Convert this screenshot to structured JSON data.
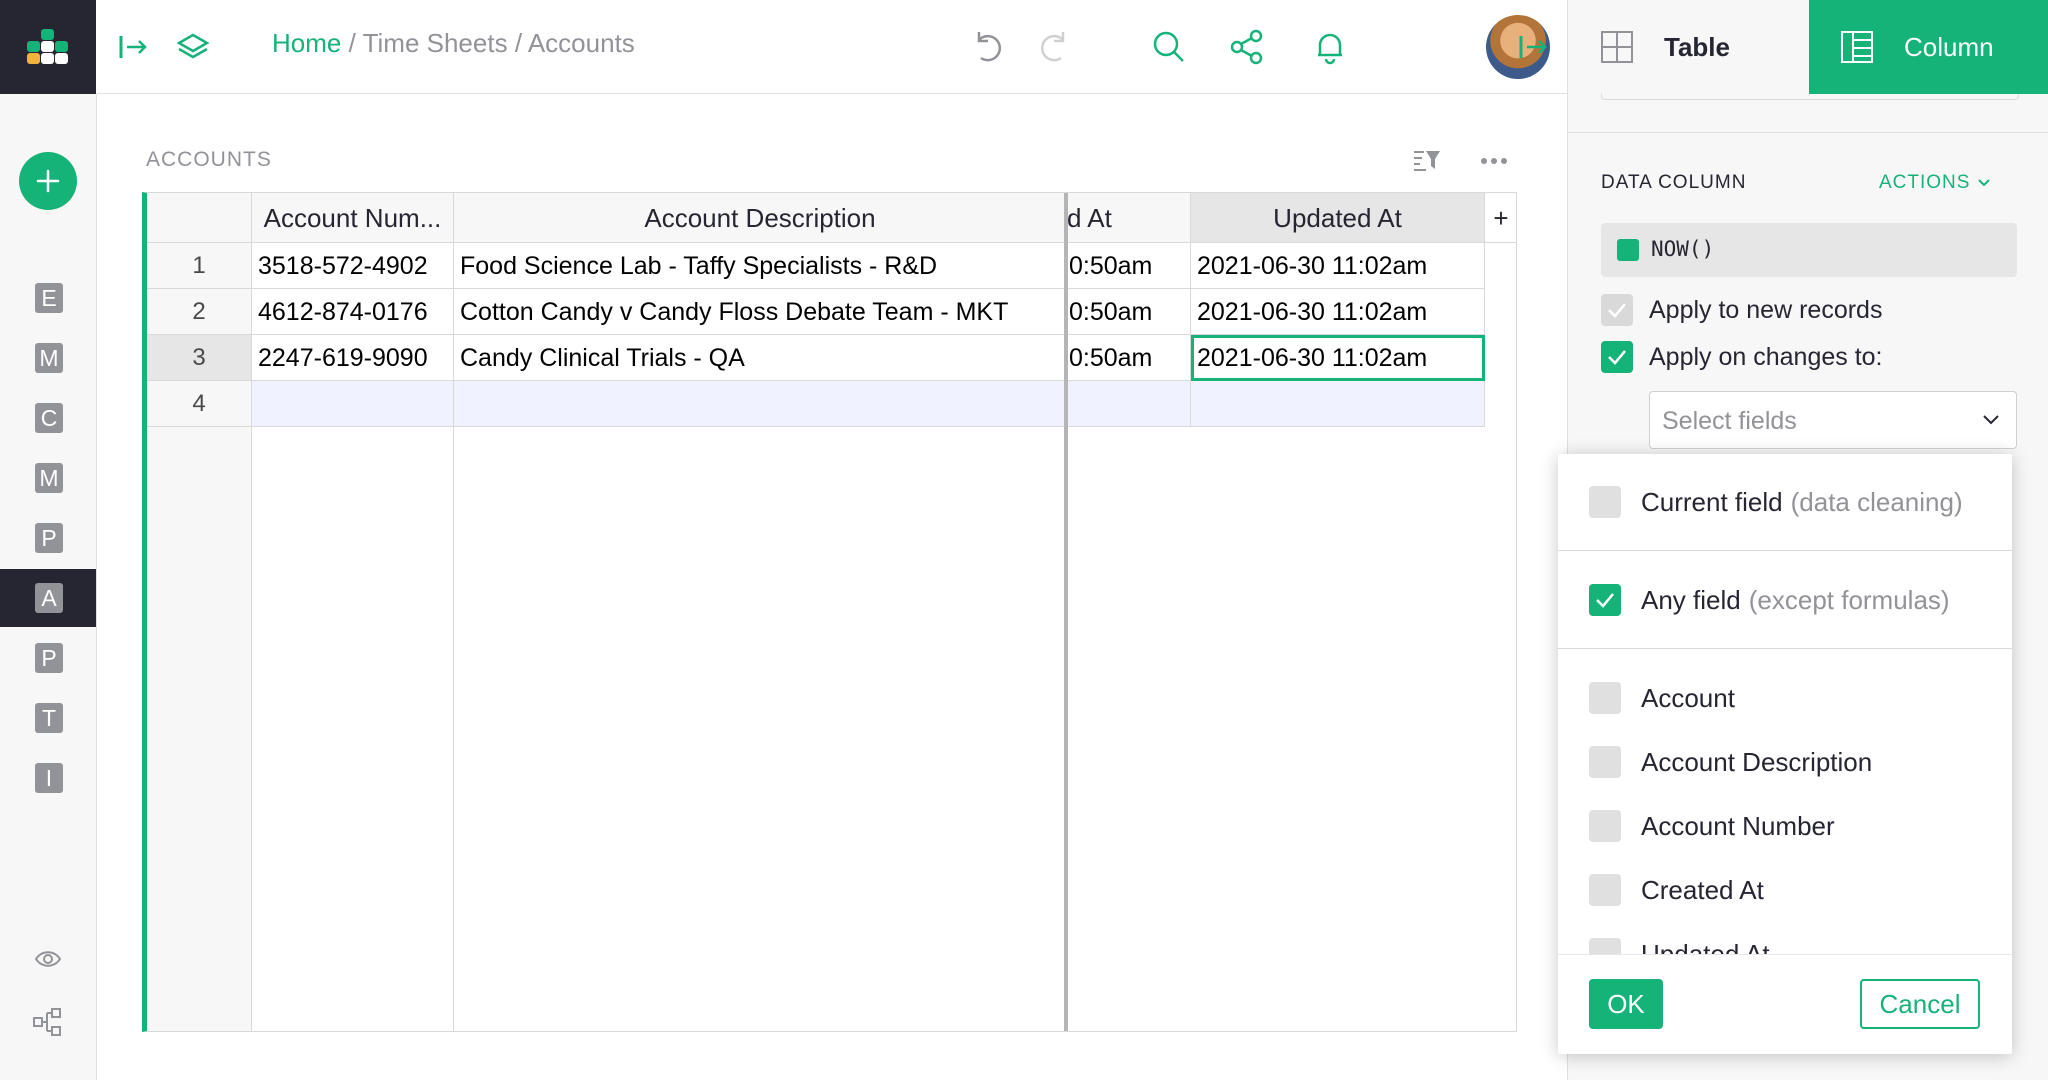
{
  "breadcrumb": {
    "home": "Home",
    "sep": "/",
    "doc": "Time Sheets",
    "page": "Accounts"
  },
  "pages": [
    "E",
    "M",
    "C",
    "M",
    "P",
    "A",
    "P",
    "T",
    "I"
  ],
  "section": {
    "title": "ACCOUNTS"
  },
  "grid": {
    "columns": [
      "Account Num...",
      "Account Description",
      "d At",
      "Updated At",
      "+"
    ],
    "rows": [
      {
        "n": "1",
        "number": "3518-572-4902",
        "desc": "Food Science Lab - Taffy Specialists - R&D",
        "created": "0:50am",
        "updated": "2021-06-30 11:02am"
      },
      {
        "n": "2",
        "number": "4612-874-0176",
        "desc": "Cotton Candy v Candy Floss Debate Team - MKT",
        "created": "0:50am",
        "updated": "2021-06-30 11:02am"
      },
      {
        "n": "3",
        "number": "2247-619-9090",
        "desc": "Candy Clinical Trials - QA",
        "created": "0:50am",
        "updated": "2021-06-30 11:02am"
      },
      {
        "n": "4",
        "number": "",
        "desc": "",
        "created": "",
        "updated": ""
      }
    ]
  },
  "panel": {
    "tab_table": "Table",
    "tab_column": "Column",
    "section_label": "DATA COLUMN",
    "actions": "ACTIONS",
    "formula": "NOW()",
    "apply_new": "Apply to new records",
    "apply_changes": "Apply on changes to:",
    "select_placeholder": "Select fields"
  },
  "dropdown": {
    "current_field": "Current field",
    "current_hint": "(data cleaning)",
    "any_field": "Any field",
    "any_hint": "(except formulas)",
    "fields": [
      "Account",
      "Account Description",
      "Account Number",
      "Created At",
      "Updated At"
    ],
    "ok": "OK",
    "cancel": "Cancel"
  },
  "colors": {
    "accent": "#16b378",
    "dark": "#262633"
  }
}
